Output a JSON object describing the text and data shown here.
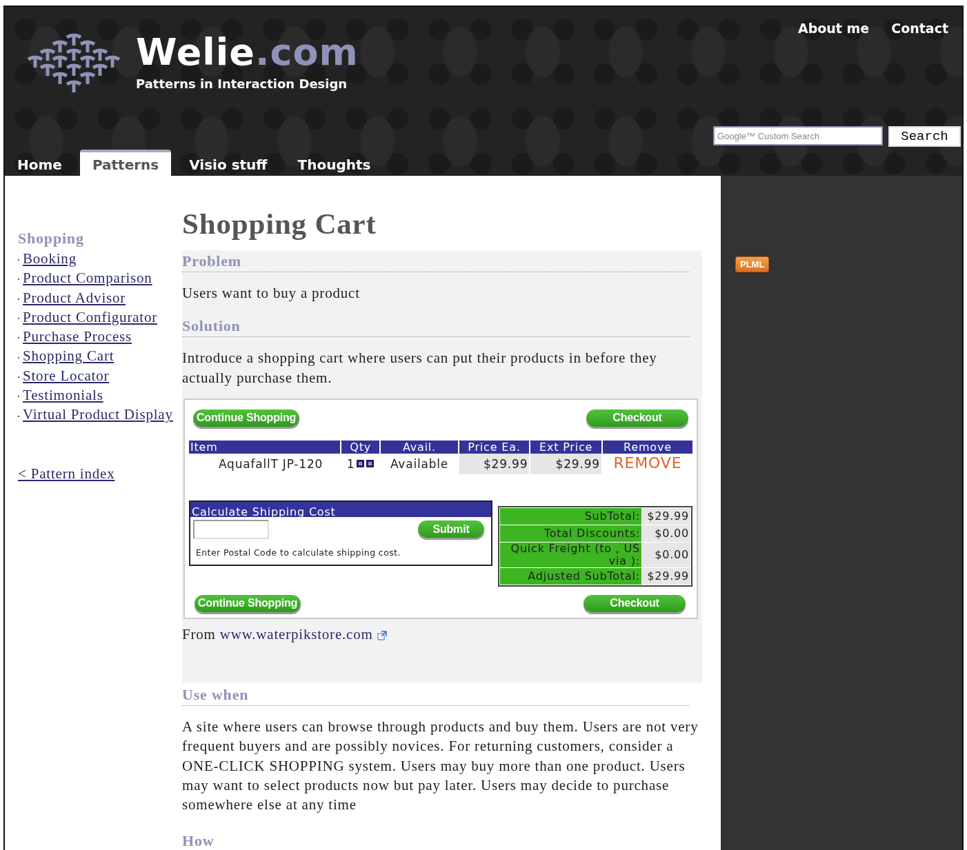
{
  "header": {
    "logo_name": "Welie",
    "logo_domain": ".com",
    "tagline": "Patterns in Interaction Design",
    "top_links": [
      "About me",
      "Contact"
    ],
    "search": {
      "placeholder": "Google™ Custom Search",
      "button": "Search"
    },
    "tabs": [
      {
        "label": "Home",
        "selected": false
      },
      {
        "label": "Patterns",
        "selected": true
      },
      {
        "label": "Visio stuff",
        "selected": false
      },
      {
        "label": "Thoughts",
        "selected": false
      }
    ]
  },
  "sidebar": {
    "heading": "Shopping",
    "items": [
      "Booking",
      "Product Comparison",
      "Product Advisor",
      "Product Configurator",
      "Purchase Process",
      "Shopping Cart",
      "Store Locator",
      "Testimonials",
      "Virtual Product Display"
    ],
    "back_link": "< Pattern index"
  },
  "article": {
    "title": "Shopping Cart",
    "problem": {
      "heading": "Problem",
      "text": "Users want to buy a product"
    },
    "solution": {
      "heading": "Solution",
      "text": "Introduce a shopping cart where users can put their products in before they actually purchase them."
    },
    "cart": {
      "top_buttons": {
        "continue": "Continue Shopping",
        "checkout": "Checkout"
      },
      "bottom_buttons": {
        "continue": "Continue Shopping",
        "checkout": "Checkout"
      },
      "columns": [
        "Item",
        "Qty",
        "Avail.",
        "Price Ea.",
        "Ext Price",
        "Remove"
      ],
      "rows": [
        {
          "item": "AquafallT JP-120",
          "qty": "1",
          "avail": "Available",
          "price": "$29.99",
          "ext_price": "$29.99",
          "remove": "REMOVE"
        }
      ],
      "shipping": {
        "title": "Calculate Shipping Cost",
        "button": "Submit",
        "hint": "Enter Postal Code to calculate shipping cost."
      },
      "totals": [
        {
          "label": "SubTotal:",
          "value": "$29.99"
        },
        {
          "label": "Total Discounts:",
          "value": "$0.00"
        },
        {
          "label": "Quick Freight (to , US via ):",
          "value": "$0.00"
        },
        {
          "label": "Adjusted SubTotal:",
          "value": "$29.99"
        }
      ]
    },
    "source": {
      "prefix": "From",
      "link": "www.waterpikstore.com"
    },
    "use_when": {
      "heading": "Use when",
      "text": "A site where users can browse through products and buy them. Users are not very frequent buyers and are possibly novices. For returning customers, consider a ONE-CLICK SHOPPING system. Users may buy more than one product. Users may want to select products now but pay later. Users may decide to purchase somewhere else at any time"
    },
    "how": {
      "heading": "How"
    }
  },
  "right_rail": {
    "badge": "PLML"
  }
}
